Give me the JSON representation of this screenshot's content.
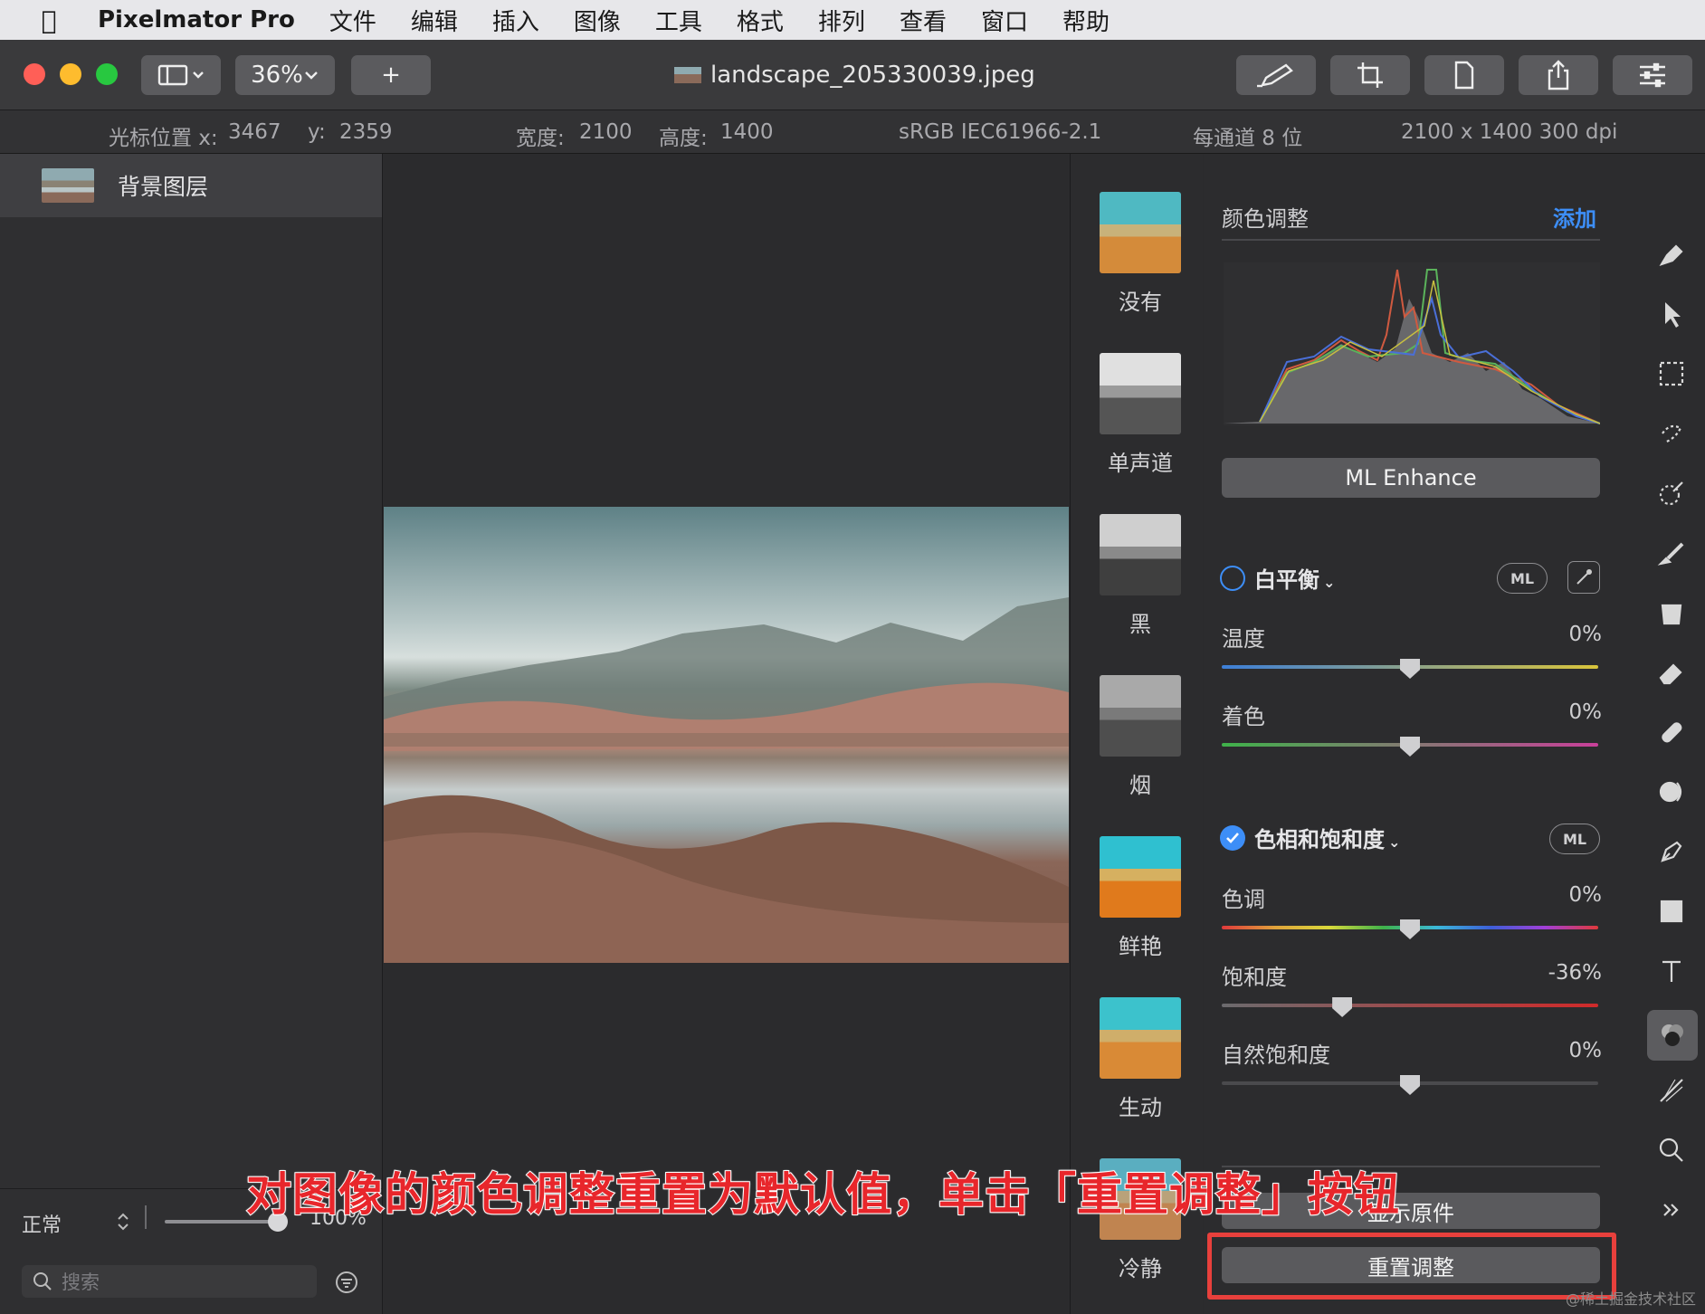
{
  "menubar": {
    "app": "Pixelmator Pro",
    "items": [
      "文件",
      "编辑",
      "插入",
      "图像",
      "工具",
      "格式",
      "排列",
      "查看",
      "窗口",
      "帮助"
    ]
  },
  "toolbar": {
    "zoom": "36%",
    "add": "+",
    "filename": "landscape_205330039.jpeg"
  },
  "info": {
    "cursor_x_label": "光标位置 x:",
    "cursor_x": "3467",
    "cursor_y_label": "y:",
    "cursor_y": "2359",
    "width_label": "宽度:",
    "width": "2100",
    "height_label": "高度:",
    "height": "1400",
    "profile": "sRGB IEC61966-2.1",
    "depth": "每通道 8 位",
    "size": "2100 x 1400 300 dpi"
  },
  "layers": {
    "name": "背景图层",
    "blend": "正常",
    "opacity": "100%",
    "opacity_value": 1.0,
    "search_placeholder": "搜索"
  },
  "presets": [
    "没有",
    "单声道",
    "黑",
    "烟",
    "鲜艳",
    "生动",
    "冷静"
  ],
  "adjust": {
    "title": "颜色调整",
    "add": "添加",
    "ml_enhance": "ML Enhance",
    "white_balance": {
      "title": "白平衡",
      "checked": false,
      "ml": "ML",
      "temperature": {
        "label": "温度",
        "value": "0%",
        "pos": 0.5
      },
      "tint": {
        "label": "着色",
        "value": "0%",
        "pos": 0.5
      }
    },
    "hue_sat": {
      "title": "色相和饱和度",
      "checked": true,
      "ml": "ML",
      "hue": {
        "label": "色调",
        "value": "0%",
        "pos": 0.5
      },
      "saturation": {
        "label": "饱和度",
        "value": "-36%",
        "pos": 0.32
      },
      "vibrance": {
        "label": "自然饱和度",
        "value": "0%",
        "pos": 0.5
      }
    },
    "show_original": "显示原件",
    "reset": "重置调整"
  },
  "annotation": "对图像的颜色调整重置为默认值，单击「重置调整」按钮",
  "watermark": "@稀土掘金技术社区",
  "colors": {
    "accent": "#3d8ef7",
    "highlight": "#e8403c",
    "annotation": "#e8262b"
  }
}
